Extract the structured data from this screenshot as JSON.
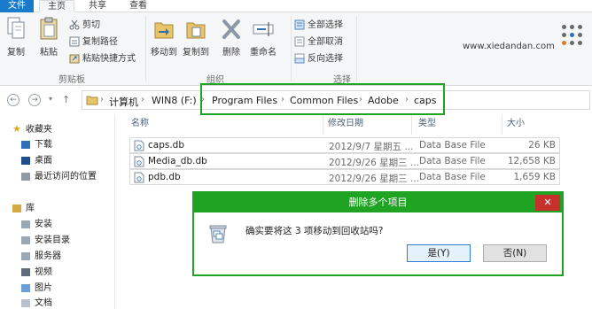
{
  "ribbon_tabs": {
    "file": "文件",
    "home": "主页",
    "share": "共享",
    "view": "查看"
  },
  "clipboard": {
    "copy": "复制",
    "paste": "粘贴",
    "cut": "剪切",
    "copy_path": "复制路径",
    "paste_shortcut": "粘贴快捷方式",
    "group": "剪贴板"
  },
  "organize": {
    "move_to": "移动到",
    "copy_to": "复制到",
    "delete": "删除",
    "rename": "重命名",
    "group": "组织"
  },
  "select": {
    "select_all": "全部选择",
    "select_none": "全部取消",
    "invert": "反向选择",
    "group": "选择"
  },
  "watermark": "www.xiedandan.com",
  "address": {
    "crumbs": [
      "计算机",
      "WIN8 (F:)",
      "Program Files",
      "Common Files",
      "Adobe",
      "caps"
    ]
  },
  "nav_pane": {
    "favorites": "收藏夹",
    "favorites_items": [
      "下载",
      "桌面",
      "最近访问的位置"
    ],
    "libraries": "库",
    "library_items": [
      "安装",
      "安装目录",
      "服务器",
      "视频",
      "图片",
      "文档"
    ]
  },
  "columns": {
    "name": "名称",
    "modified": "修改日期",
    "type": "类型",
    "size": "大小"
  },
  "files": [
    {
      "name": "caps.db",
      "modified": "2012/9/7 星期五 ...",
      "type": "Data Base File",
      "size": "26 KB"
    },
    {
      "name": "Media_db.db",
      "modified": "2012/9/26 星期三 ...",
      "type": "Data Base File",
      "size": "12,658 KB"
    },
    {
      "name": "pdb.db",
      "modified": "2012/9/26 星期三 ...",
      "type": "Data Base File",
      "size": "1,659 KB"
    }
  ],
  "dialog": {
    "title": "删除多个项目",
    "close": "✕",
    "message": "确实要将这 3 项移动到回收站吗?",
    "yes": "是(Y)",
    "no": "否(N)"
  },
  "colors": {
    "accent_green": "#1fa323",
    "file_tab_blue": "#1979ca",
    "close_red": "#c7312b"
  }
}
